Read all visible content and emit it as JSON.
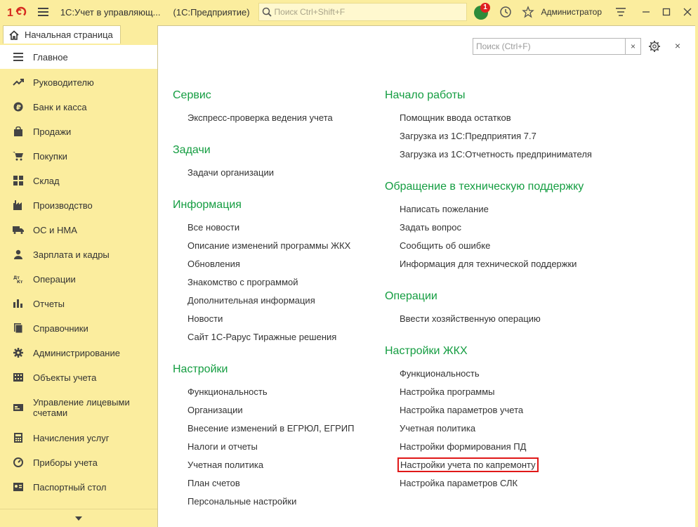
{
  "titlebar": {
    "app_title": "1С:Учет в управляющ...",
    "app_sub": "(1С:Предприятие)",
    "search_placeholder": "Поиск Ctrl+Shift+F",
    "notification_count": "1",
    "user": "Администратор"
  },
  "tabs": {
    "home_label": "Начальная страница"
  },
  "sidebar": {
    "items": [
      {
        "label": "Главное",
        "icon": "menu-icon"
      },
      {
        "label": "Руководителю",
        "icon": "trend-icon"
      },
      {
        "label": "Банк и касса",
        "icon": "ruble-icon"
      },
      {
        "label": "Продажи",
        "icon": "bag-icon"
      },
      {
        "label": "Покупки",
        "icon": "cart-icon"
      },
      {
        "label": "Склад",
        "icon": "warehouse-icon"
      },
      {
        "label": "Производство",
        "icon": "factory-icon"
      },
      {
        "label": "ОС и НМА",
        "icon": "truck-icon"
      },
      {
        "label": "Зарплата и кадры",
        "icon": "person-icon"
      },
      {
        "label": "Операции",
        "icon": "dt-kt-icon"
      },
      {
        "label": "Отчеты",
        "icon": "bar-chart-icon"
      },
      {
        "label": "Справочники",
        "icon": "book-icon"
      },
      {
        "label": "Администрирование",
        "icon": "gear-icon"
      },
      {
        "label": "Объекты учета",
        "icon": "building-icon"
      },
      {
        "label": "Управление лицевыми счетами",
        "icon": "account-icon"
      },
      {
        "label": "Начисления услуг",
        "icon": "calculator-icon"
      },
      {
        "label": "Приборы учета",
        "icon": "meter-icon"
      },
      {
        "label": "Паспортный стол",
        "icon": "passport-icon"
      }
    ]
  },
  "panel": {
    "search_placeholder": "Поиск (Ctrl+F)",
    "clear_label": "×",
    "close_label": "×"
  },
  "sections": {
    "service": {
      "title": "Сервис",
      "links": [
        "Экспресс-проверка ведения учета"
      ]
    },
    "tasks": {
      "title": "Задачи",
      "links": [
        "Задачи организации"
      ]
    },
    "info": {
      "title": "Информация",
      "links": [
        "Все новости",
        "Описание изменений программы ЖКХ",
        "Обновления",
        "Знакомство с программой",
        "Дополнительная информация",
        "Новости",
        "Сайт 1С-Рарус Тиражные решения"
      ]
    },
    "settings": {
      "title": "Настройки",
      "links": [
        "Функциональность",
        "Организации",
        "Внесение изменений в ЕГРЮЛ, ЕГРИП",
        "Налоги и отчеты",
        "Учетная политика",
        "План счетов",
        "Персональные настройки"
      ]
    },
    "start": {
      "title": "Начало работы",
      "links": [
        "Помощник ввода остатков",
        "Загрузка из 1С:Предприятия 7.7",
        "Загрузка из 1С:Отчетность предпринимателя"
      ]
    },
    "support": {
      "title": "Обращение в техническую поддержку",
      "links": [
        "Написать пожелание",
        "Задать вопрос",
        "Сообщить об ошибке",
        "Информация для технической поддержки"
      ]
    },
    "operations": {
      "title": "Операции",
      "links": [
        "Ввести хозяйственную операцию"
      ]
    },
    "zkh": {
      "title": "Настройки ЖКХ",
      "links": [
        "Функциональность",
        "Настройка программы",
        "Настройка параметров учета",
        "Учетная политика",
        "Настройки формирования ПД",
        "Настройки учета по капремонту",
        "Настройка параметров СЛК"
      ]
    }
  },
  "colors": {
    "accent_green": "#149d41",
    "sidebar_bg": "#fbed9e",
    "highlight_red": "#e01818"
  }
}
